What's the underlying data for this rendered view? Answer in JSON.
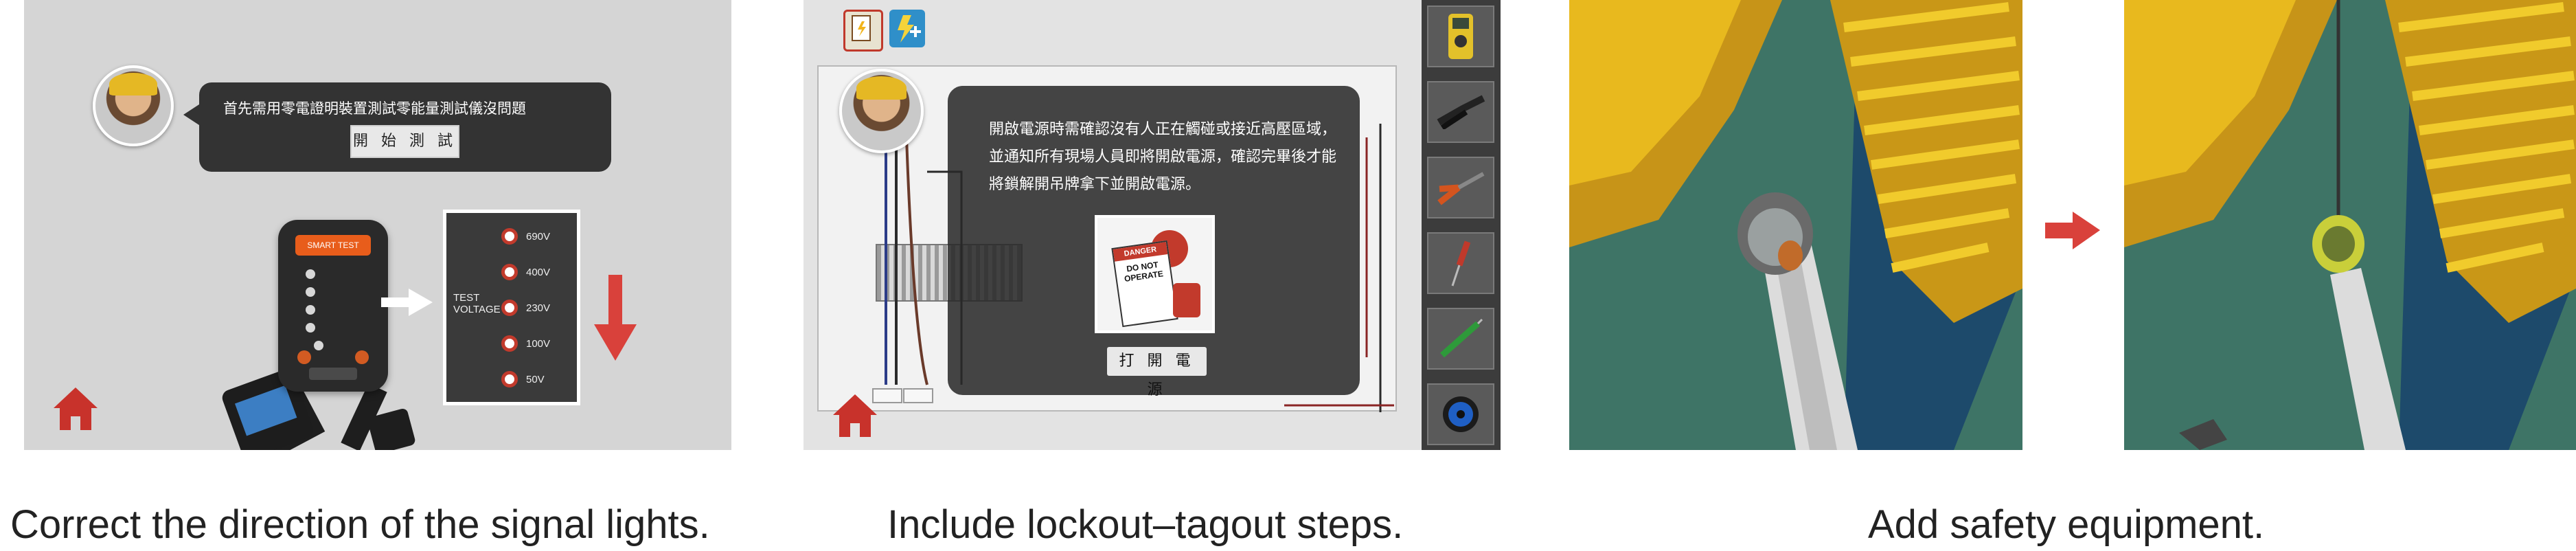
{
  "panel1": {
    "dialog_text": "首先需用零電證明裝置測試零能量測試儀沒問題",
    "start_button": "開 始 測 試",
    "device_brand": "SMART TEST",
    "voltage_levels": [
      "690V",
      "400V",
      "230V",
      "100V",
      "50V"
    ],
    "test_voltage_label": "TEST VOLTAGE",
    "caption": "Correct the direction of the signal lights."
  },
  "panel2": {
    "dialog_lines": [
      "開啟電源時需確認沒有人正在觸碰或接近高壓區域，",
      "並通知所有現場人員即將開啟電源，確認完畢後才能",
      "將鎖解開吊牌拿下並開啟電源。"
    ],
    "tag_lines": [
      "DANGER",
      "DO NOT",
      "OPERATE"
    ],
    "power_button": "打 開 電 源",
    "tools": [
      "multimeter-icon",
      "wire-stripper-icon",
      "pliers-icon",
      "screwdriver-icon",
      "voltage-tester-icon",
      "cable-reel-icon"
    ],
    "caption": "Include lockout–tagout steps."
  },
  "panel3": {
    "caption": "Add safety equipment."
  },
  "colors": {
    "home_red": "#c8322b",
    "arrow_red": "#d9413b",
    "dialog_bg": "#2e2e2e",
    "yellow_structure": "#e6b81e",
    "sea_green": "#3f7467"
  }
}
